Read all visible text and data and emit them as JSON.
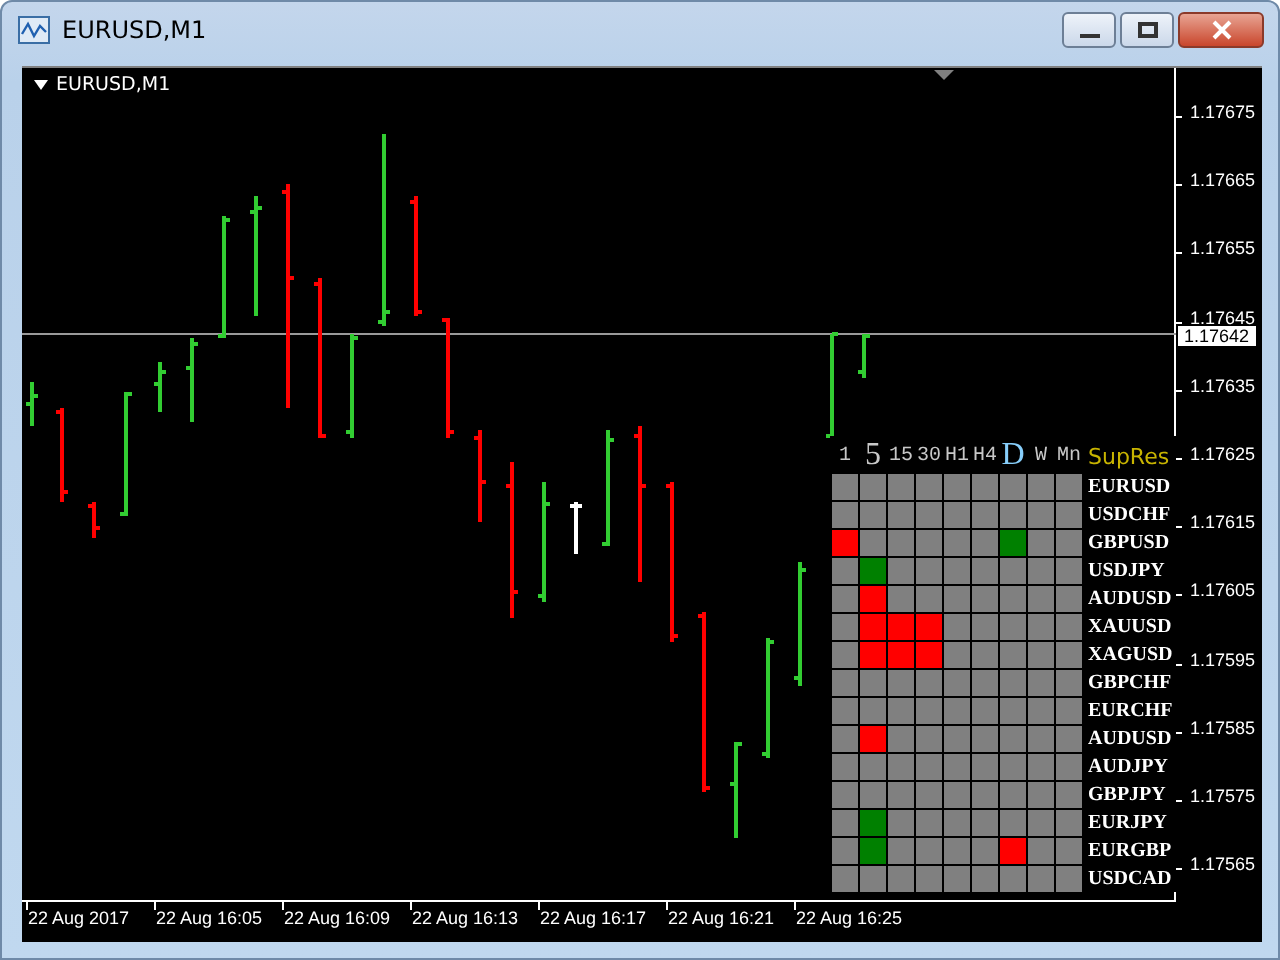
{
  "window": {
    "title": "EURUSD,M1"
  },
  "chart": {
    "label": "EURUSD,M1",
    "price_axis": [
      "1.17675",
      "1.17665",
      "1.17655",
      "1.17645",
      "1.17635",
      "1.17625",
      "1.17615",
      "1.17605",
      "1.17595",
      "1.17585",
      "1.17575",
      "1.17565"
    ],
    "current_price": "1.17642",
    "time_axis": [
      "22 Aug 2017",
      "22 Aug 16:05",
      "22 Aug 16:09",
      "22 Aug 16:13",
      "22 Aug 16:17",
      "22 Aug 16:21",
      "22 Aug 16:25"
    ]
  },
  "panel": {
    "columns": [
      {
        "label": "1",
        "selected": false
      },
      {
        "label": "5",
        "selected": true
      },
      {
        "label": "15",
        "selected": false
      },
      {
        "label": "30",
        "selected": false
      },
      {
        "label": "H1",
        "selected": false
      },
      {
        "label": "H4",
        "selected": false
      },
      {
        "label": "D",
        "selected": true
      },
      {
        "label": "W",
        "selected": false
      },
      {
        "label": "Mn",
        "selected": false
      }
    ],
    "symbols_heading": "SupRes",
    "rows": [
      {
        "symbol": "EURUSD",
        "cells": [
          {
            "color": "#808080"
          },
          {
            "color": "#808080"
          },
          {
            "color": "#808080"
          },
          {
            "color": "#808080"
          },
          {
            "color": "#808080"
          },
          {
            "color": "#808080"
          },
          {
            "color": "#808080"
          },
          {
            "color": "#808080"
          },
          {
            "color": "#808080"
          }
        ]
      },
      {
        "symbol": "USDCHF",
        "cells": [
          {
            "color": "#808080"
          },
          {
            "color": "#808080"
          },
          {
            "color": "#808080"
          },
          {
            "color": "#808080"
          },
          {
            "color": "#808080"
          },
          {
            "color": "#808080"
          },
          {
            "color": "#808080"
          },
          {
            "color": "#808080"
          },
          {
            "color": "#808080"
          }
        ]
      },
      {
        "symbol": "GBPUSD",
        "cells": [
          {
            "color": "#ff0000"
          },
          {
            "color": "#808080"
          },
          {
            "color": "#808080"
          },
          {
            "color": "#808080"
          },
          {
            "color": "#808080"
          },
          {
            "color": "#808080"
          },
          {
            "color": "#008000"
          },
          {
            "color": "#808080"
          },
          {
            "color": "#808080"
          }
        ]
      },
      {
        "symbol": "USDJPY",
        "cells": [
          {
            "color": "#808080"
          },
          {
            "color": "#008000"
          },
          {
            "color": "#808080"
          },
          {
            "color": "#808080"
          },
          {
            "color": "#808080"
          },
          {
            "color": "#808080"
          },
          {
            "color": "#808080"
          },
          {
            "color": "#808080"
          },
          {
            "color": "#808080"
          }
        ]
      },
      {
        "symbol": "AUDUSD",
        "cells": [
          {
            "color": "#808080"
          },
          {
            "color": "#ff0000"
          },
          {
            "color": "#808080"
          },
          {
            "color": "#808080"
          },
          {
            "color": "#808080"
          },
          {
            "color": "#808080"
          },
          {
            "color": "#808080"
          },
          {
            "color": "#808080"
          },
          {
            "color": "#808080"
          }
        ]
      },
      {
        "symbol": "XAUUSD",
        "cells": [
          {
            "color": "#808080"
          },
          {
            "color": "#ff0000"
          },
          {
            "color": "#ff0000"
          },
          {
            "color": "#ff0000"
          },
          {
            "color": "#808080"
          },
          {
            "color": "#808080"
          },
          {
            "color": "#808080"
          },
          {
            "color": "#808080"
          },
          {
            "color": "#808080"
          }
        ]
      },
      {
        "symbol": "XAGUSD",
        "cells": [
          {
            "color": "#808080"
          },
          {
            "color": "#ff0000"
          },
          {
            "color": "#ff0000"
          },
          {
            "color": "#ff0000"
          },
          {
            "color": "#808080"
          },
          {
            "color": "#808080"
          },
          {
            "color": "#808080"
          },
          {
            "color": "#808080"
          },
          {
            "color": "#808080"
          }
        ]
      },
      {
        "symbol": "GBPCHF",
        "cells": [
          {
            "color": "#808080"
          },
          {
            "color": "#808080"
          },
          {
            "color": "#808080"
          },
          {
            "color": "#808080"
          },
          {
            "color": "#808080"
          },
          {
            "color": "#808080"
          },
          {
            "color": "#808080"
          },
          {
            "color": "#808080"
          },
          {
            "color": "#808080"
          }
        ]
      },
      {
        "symbol": "EURCHF",
        "cells": [
          {
            "color": "#808080"
          },
          {
            "color": "#808080"
          },
          {
            "color": "#808080"
          },
          {
            "color": "#808080"
          },
          {
            "color": "#808080"
          },
          {
            "color": "#808080"
          },
          {
            "color": "#808080"
          },
          {
            "color": "#808080"
          },
          {
            "color": "#808080"
          }
        ]
      },
      {
        "symbol": "AUDUSD",
        "cells": [
          {
            "color": "#808080"
          },
          {
            "color": "#ff0000"
          },
          {
            "color": "#808080"
          },
          {
            "color": "#808080"
          },
          {
            "color": "#808080"
          },
          {
            "color": "#808080"
          },
          {
            "color": "#808080"
          },
          {
            "color": "#808080"
          },
          {
            "color": "#808080"
          }
        ]
      },
      {
        "symbol": "AUDJPY",
        "cells": [
          {
            "color": "#808080"
          },
          {
            "color": "#808080"
          },
          {
            "color": "#808080"
          },
          {
            "color": "#808080"
          },
          {
            "color": "#808080"
          },
          {
            "color": "#808080"
          },
          {
            "color": "#808080"
          },
          {
            "color": "#808080"
          },
          {
            "color": "#808080"
          }
        ]
      },
      {
        "symbol": "GBPJPY",
        "cells": [
          {
            "color": "#808080"
          },
          {
            "color": "#808080"
          },
          {
            "color": "#808080"
          },
          {
            "color": "#808080"
          },
          {
            "color": "#808080"
          },
          {
            "color": "#808080"
          },
          {
            "color": "#808080"
          },
          {
            "color": "#808080"
          },
          {
            "color": "#808080"
          }
        ]
      },
      {
        "symbol": "EURJPY",
        "cells": [
          {
            "color": "#808080"
          },
          {
            "color": "#008000"
          },
          {
            "color": "#808080"
          },
          {
            "color": "#808080"
          },
          {
            "color": "#808080"
          },
          {
            "color": "#808080"
          },
          {
            "color": "#808080"
          },
          {
            "color": "#808080"
          },
          {
            "color": "#808080"
          }
        ]
      },
      {
        "symbol": "EURGBP",
        "cells": [
          {
            "color": "#808080"
          },
          {
            "color": "#008000"
          },
          {
            "color": "#808080"
          },
          {
            "color": "#808080"
          },
          {
            "color": "#808080"
          },
          {
            "color": "#808080"
          },
          {
            "color": "#ff0000"
          },
          {
            "color": "#808080"
          },
          {
            "color": "#808080"
          }
        ]
      },
      {
        "symbol": "USDCAD",
        "cells": [
          {
            "color": "#808080"
          },
          {
            "color": "#808080"
          },
          {
            "color": "#808080"
          },
          {
            "color": "#808080"
          },
          {
            "color": "#808080"
          },
          {
            "color": "#808080"
          },
          {
            "color": "#808080"
          },
          {
            "color": "#808080"
          },
          {
            "color": "#808080"
          }
        ]
      }
    ]
  }
}
